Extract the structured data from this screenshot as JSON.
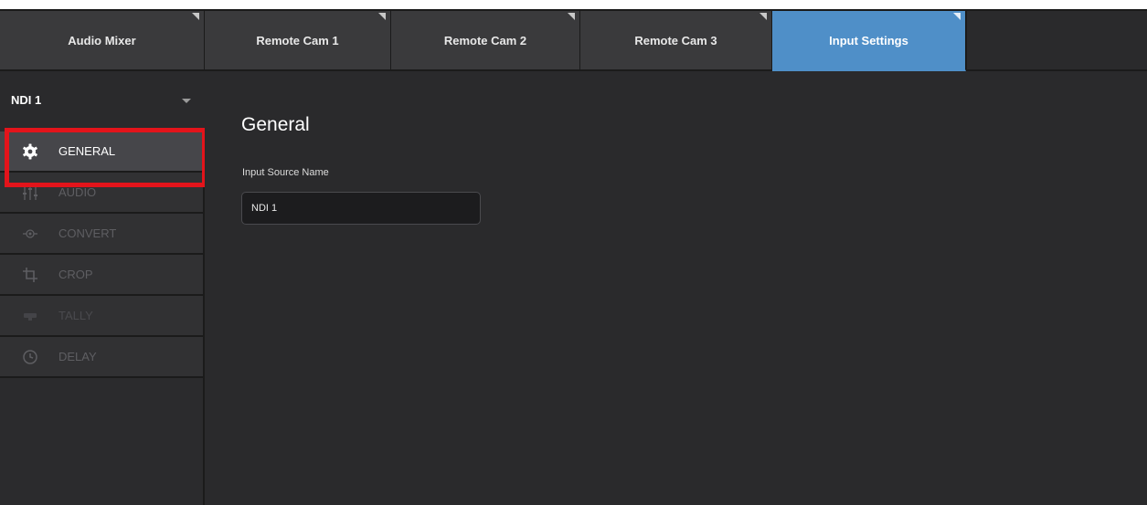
{
  "tabs": [
    {
      "label": "Audio Mixer",
      "active": false
    },
    {
      "label": "Remote Cam 1",
      "active": false
    },
    {
      "label": "Remote Cam 2",
      "active": false
    },
    {
      "label": "Remote Cam 3",
      "active": false
    },
    {
      "label": "Input Settings",
      "active": true
    }
  ],
  "source_select": {
    "value": "NDI 1",
    "highlight_color": "#e3141b"
  },
  "nav": {
    "items": [
      {
        "label": "GENERAL",
        "icon": "gear-icon",
        "active": true
      },
      {
        "label": "AUDIO",
        "icon": "audio-sliders-icon",
        "active": false
      },
      {
        "label": "CONVERT",
        "icon": "convert-icon",
        "active": false
      },
      {
        "label": "CROP",
        "icon": "crop-icon",
        "active": false
      },
      {
        "label": "TALLY",
        "icon": "tally-icon",
        "active": false
      },
      {
        "label": "DELAY",
        "icon": "clock-icon",
        "active": false
      }
    ]
  },
  "main": {
    "section_title": "General",
    "input_source_label": "Input Source Name",
    "input_source_value": "NDI 1"
  },
  "colors": {
    "accent": "#4f8fc8",
    "background": "#2a2a2c"
  }
}
